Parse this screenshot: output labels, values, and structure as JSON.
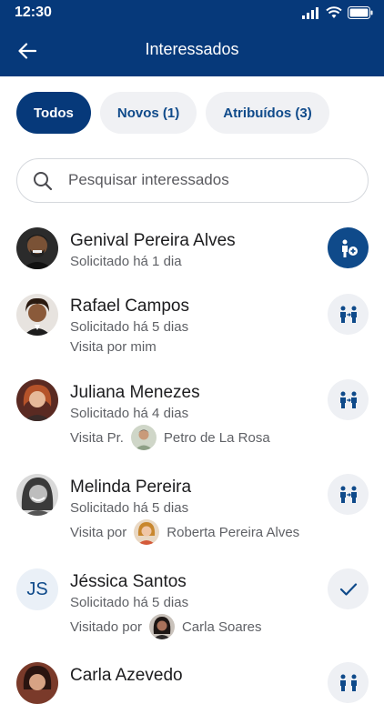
{
  "status": {
    "time": "12:30"
  },
  "header": {
    "title": "Interessados"
  },
  "filters": [
    {
      "label": "Todos"
    },
    {
      "label": "Novos (1)"
    },
    {
      "label": "Atribuídos (3)"
    }
  ],
  "search": {
    "placeholder": "Pesquisar interessados"
  },
  "people": [
    {
      "name": "Genival Pereira Alves",
      "requested": "Solicitado há 1 dia"
    },
    {
      "name": "Rafael Campos",
      "requested": "Solicitado há 5 dias",
      "visit_label": "Visita por mim"
    },
    {
      "name": "Juliana Menezes",
      "requested": "Solicitado há 4 dias",
      "visit_label": "Visita Pr.",
      "agent": "Petro de La Rosa"
    },
    {
      "name": "Melinda Pereira",
      "requested": "Solicitado há 5 dias",
      "visit_label": "Visita por",
      "agent": "Roberta Pereira Alves"
    },
    {
      "name": "Jéssica Santos",
      "initials": "JS",
      "requested": "Solicitado há 5 dias",
      "visit_label": "Visitado por",
      "agent": "Carla Soares"
    },
    {
      "name": "Carla Azevedo"
    }
  ],
  "colors": {
    "primary": "#06397a",
    "accent": "#0f4a8a",
    "chip_bg": "#f0f1f4"
  }
}
